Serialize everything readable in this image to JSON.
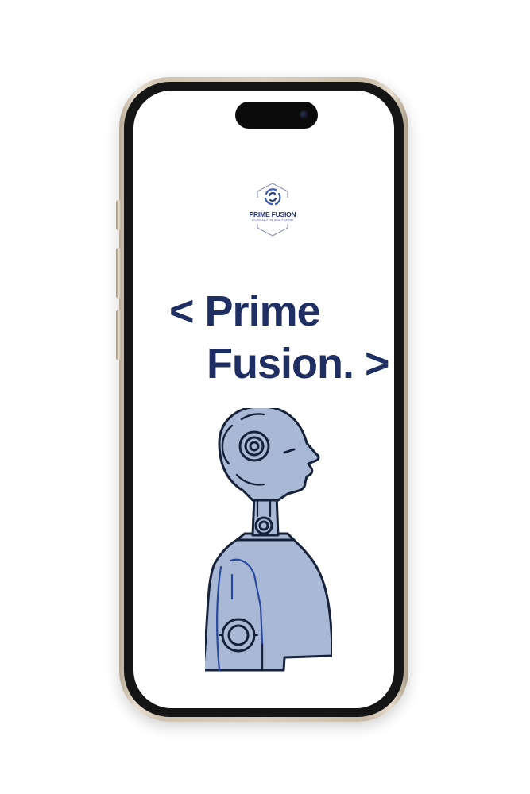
{
  "screen": {
    "logo": {
      "name": "PRIME FUSION",
      "tagline": "YOU DREAM IT, WE MAKE IT HAPPEN"
    },
    "headline": {
      "line_1": "< Prime",
      "line_2": "Fusion. >"
    },
    "illustration": {
      "icon": "robot-bust-icon"
    }
  },
  "colors": {
    "brand_navy": "#1f2f63",
    "robot_fill": "#a9b8d4",
    "robot_outline": "#16213a",
    "robot_panel_line": "#2848a0",
    "phone_frame": "#d9cfbf",
    "phone_bezel": "#151515",
    "screen_bg": "#ffffff"
  }
}
